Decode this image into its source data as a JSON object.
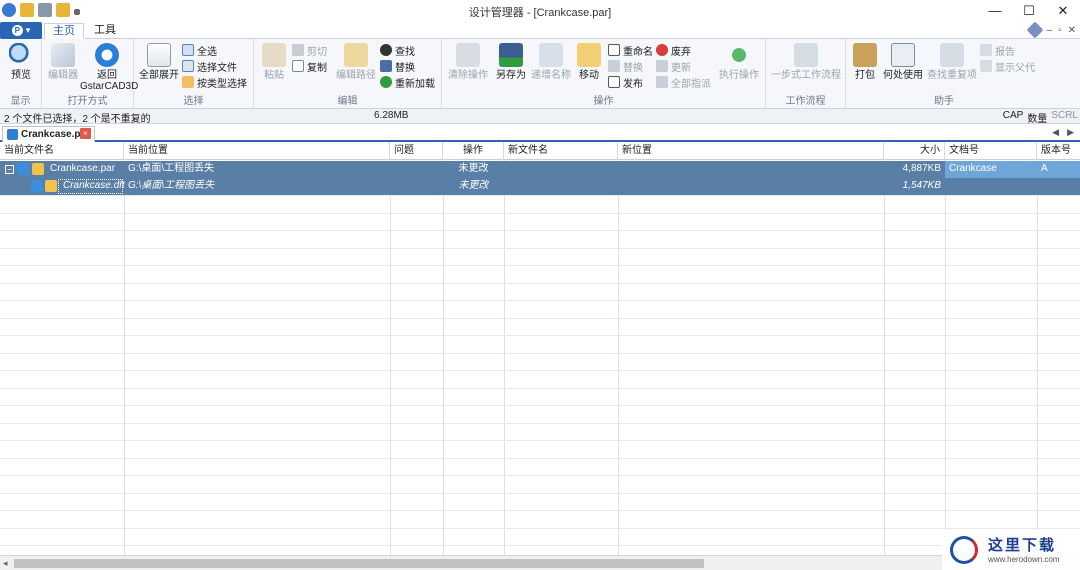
{
  "window": {
    "title": "设计管理器 - [Crankcase.par]",
    "minimize": "—",
    "maximize": "☐",
    "close": "✕"
  },
  "tabs": {
    "home": "主页",
    "tools": "工具",
    "right_controls": [
      "–",
      "▫",
      "✕"
    ]
  },
  "ribbon": {
    "display": {
      "preview": "预览",
      "caption": "显示"
    },
    "open_with": {
      "editor": "编辑器",
      "return": "返回",
      "return_sub": "GstarCAD3D",
      "caption": "打开方式"
    },
    "select": {
      "expand_all": "全部展开",
      "select_all": "全选",
      "select_file": "选择文件",
      "select_by_type": "按类型选择",
      "caption": "选择"
    },
    "edit": {
      "paste": "粘贴",
      "cut": "剪切",
      "copy": "复制",
      "edit_path": "编辑路径",
      "find": "查找",
      "replace": "替换",
      "reload": "重新加载",
      "caption": "编辑"
    },
    "actions": {
      "clear": "清除操作",
      "save_as": "另存为",
      "increment_name": "递增名称",
      "move": "移动",
      "rename": "重命名",
      "replace": "替换",
      "publish": "发布",
      "discard": "废弃",
      "update": "更新",
      "assign_all": "全部指派",
      "execute": "执行操作",
      "caption": "操作"
    },
    "workflow": {
      "one_step": "一步式工作流程",
      "caption": "工作流程"
    },
    "helper": {
      "pack": "打包",
      "where_used": "何处使用",
      "find_duplicates": "查找重复项",
      "report": "报告",
      "show_parent": "显示父代",
      "caption": "助手"
    }
  },
  "status": {
    "selection": "2 个文件已选择，2 个是不重复的",
    "size": "6.28MB",
    "cap": "CAP",
    "num": "数量",
    "scrl": "SCRL"
  },
  "doc_tab": {
    "name": "Crankcase.par",
    "close": "×"
  },
  "grid": {
    "columns": [
      "当前文件名",
      "当前位置",
      "问题",
      "操作",
      "新文件名",
      "新位置",
      "大小",
      "文档号",
      "版本号"
    ],
    "rows": [
      {
        "expander": "−",
        "filename": "Crankcase.par",
        "location": "G:\\桌面\\工程图丢失",
        "issue": "",
        "action": "未更改",
        "new_name": "",
        "new_location": "",
        "size": "4,887KB",
        "doc_number": "Crankcase",
        "revision": "A"
      },
      {
        "expander": "",
        "filename": "Crankcase.dft",
        "location": "G:\\桌面\\工程图丢失",
        "issue": "",
        "action": "未更改",
        "new_name": "",
        "new_location": "",
        "size": "1,547KB",
        "doc_number": "",
        "revision": ""
      }
    ]
  },
  "watermark": {
    "name": "这里下载",
    "url": "www.herodown.com"
  },
  "colors": {
    "accent": "#2a65b4",
    "selected_row": "#5a7fa6",
    "highlight_cell": "#6fa6da"
  }
}
